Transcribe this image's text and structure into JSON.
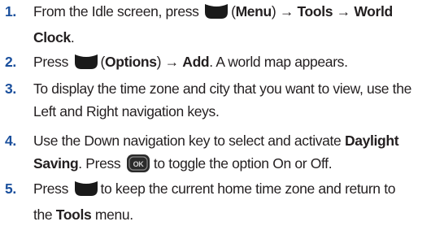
{
  "steps": [
    {
      "number": "1.",
      "parts": {
        "a": "From the Idle screen, press",
        "b": "(",
        "c": "Menu",
        "d": ") → ",
        "e": "Tools",
        "f": " → ",
        "g": "World",
        "h": "Clock",
        "i": "."
      }
    },
    {
      "number": "2.",
      "parts": {
        "a": "Press",
        "b": "(",
        "c": "Options",
        "d": ") → ",
        "e": "Add",
        "f": ". A world map appears."
      }
    },
    {
      "number": "3.",
      "parts": {
        "a": "To display the time zone and city that you want to view, use the",
        "b": "Left and Right navigation keys."
      }
    },
    {
      "number": "4.",
      "parts": {
        "a": "Use the Down navigation key to select and activate ",
        "b": "Daylight",
        "c": "Saving",
        "d": ". Press",
        "e": "to toggle the option On or Off."
      }
    },
    {
      "number": "5.",
      "parts": {
        "a": "Press",
        "b": "to keep the current home time zone and return to",
        "c": "the ",
        "d": "Tools",
        "e": " menu."
      }
    }
  ],
  "icons": {
    "soft_key": "left-soft-key-icon",
    "ok_key": "ok-key-icon",
    "ok_key_label": "OK"
  },
  "colors": {
    "step_number": "#1a4f9c",
    "text": "#231f20"
  }
}
